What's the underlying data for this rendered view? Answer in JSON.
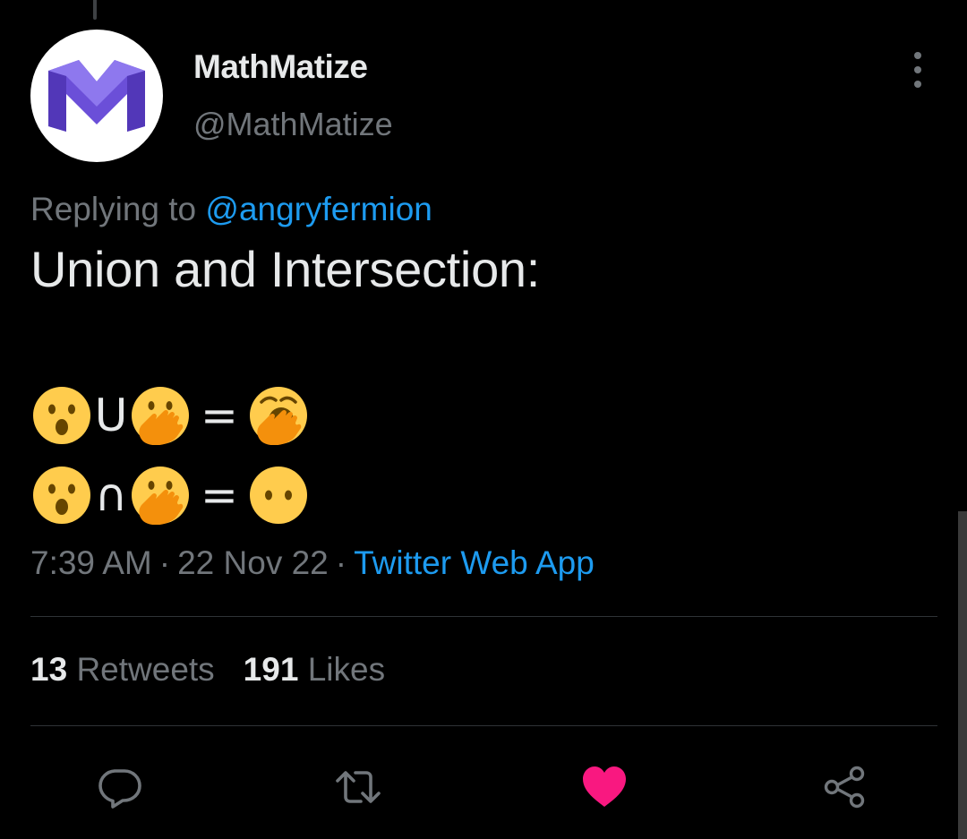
{
  "colors": {
    "background": "#000000",
    "primary_text": "#e7e9ea",
    "secondary_text": "#71767b",
    "link": "#1d9bf0",
    "like": "#f91880",
    "divider": "#2f3336",
    "avatar_logo": "#6b4fd8"
  },
  "author": {
    "display_name": "MathMatize",
    "handle": "@MathMatize",
    "avatar_icon": "mathmatize-logo"
  },
  "reply": {
    "prefix": "Replying to",
    "mention": "@angryfermion"
  },
  "tweet": {
    "text": "Union and Intersection:",
    "equations": [
      {
        "left": "hushed-face-emoji",
        "operator": "U",
        "right": "face-with-hand-over-mouth-emoji",
        "equals": "=",
        "result": "yawning-face-emoji"
      },
      {
        "left": "hushed-face-emoji",
        "operator": "∩",
        "right": "face-with-hand-over-mouth-emoji",
        "equals": "=",
        "result": "face-without-mouth-emoji"
      }
    ]
  },
  "meta": {
    "time": "7:39 AM",
    "date": "22 Nov 22",
    "separator": "·",
    "source": "Twitter Web App"
  },
  "stats": {
    "retweets_count": "13",
    "retweets_label": "Retweets",
    "likes_count": "191",
    "likes_label": "Likes"
  },
  "actions": [
    {
      "name": "reply",
      "icon": "reply-icon"
    },
    {
      "name": "retweet",
      "icon": "retweet-icon"
    },
    {
      "name": "like",
      "icon": "heart-icon",
      "active": true
    },
    {
      "name": "share",
      "icon": "share-icon"
    }
  ]
}
